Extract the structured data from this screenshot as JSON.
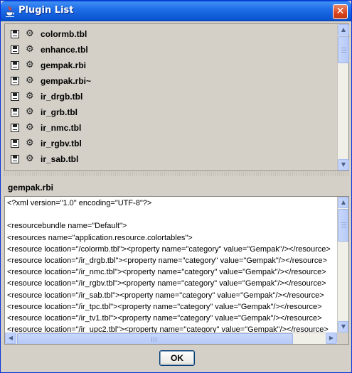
{
  "window": {
    "title": "Plugin List",
    "close_glyph": "✕",
    "icon": "java-cup-icon"
  },
  "plugins": [
    {
      "label": "colormb.tbl"
    },
    {
      "label": "enhance.tbl"
    },
    {
      "label": "gempak.rbi"
    },
    {
      "label": "gempak.rbi~"
    },
    {
      "label": "ir_drgb.tbl"
    },
    {
      "label": "ir_grb.tbl"
    },
    {
      "label": "ir_nmc.tbl"
    },
    {
      "label": "ir_rgbv.tbl"
    },
    {
      "label": "ir_sab.tbl"
    }
  ],
  "item_icons": [
    "save-disk-icon",
    "settings-gear-icon"
  ],
  "selected_file": "gempak.rbi",
  "file_lines": [
    "<?xml version=\"1.0\" encoding=\"UTF-8\"?>",
    "",
    "<resourcebundle name=\"Default\">",
    "<resources name=\"application.resource.colortables\">",
    "<resource location=\"/colormb.tbl\"><property name=\"category\" value=\"Gempak\"/></resource>",
    "<resource location=\"/ir_drgb.tbl\"><property name=\"category\" value=\"Gempak\"/></resource>",
    "<resource location=\"/ir_nmc.tbl\"><property name=\"category\" value=\"Gempak\"/></resource>",
    "<resource location=\"/ir_rgbv.tbl\"><property name=\"category\" value=\"Gempak\"/></resource>",
    "<resource location=\"/ir_sab.tbl\"><property name=\"category\" value=\"Gempak\"/></resource>",
    "<resource location=\"/ir_tpc.tbl\"><property name=\"category\" value=\"Gempak\"/></resource>",
    "<resource location=\"/ir_tv1.tbl\"><property name=\"category\" value=\"Gempak\"/></resource>",
    "<resource location=\"/ir_upc2.tbl\"><property name=\"category\" value=\"Gempak\"/></resource>"
  ],
  "ok_label": "OK"
}
